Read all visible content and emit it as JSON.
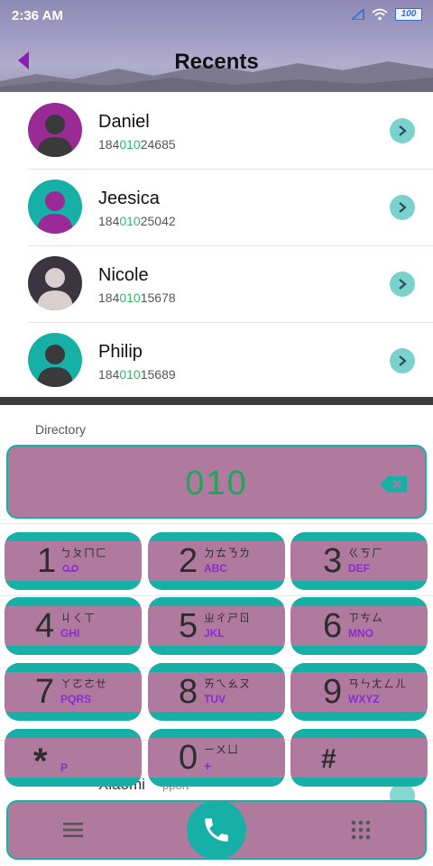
{
  "status": {
    "time": "2:36 AM",
    "battery": "100"
  },
  "header": {
    "title": "Recents"
  },
  "contacts": [
    {
      "name": "Daniel",
      "num_pre": "184",
      "num_hl": "010",
      "num_post": "24685"
    },
    {
      "name": "Jeesica",
      "num_pre": "184",
      "num_hl": "010",
      "num_post": "25042"
    },
    {
      "name": "Nicole",
      "num_pre": "184",
      "num_hl": "010",
      "num_post": "15678"
    },
    {
      "name": "Philip",
      "num_pre": "184",
      "num_hl": "010",
      "num_post": "15689"
    }
  ],
  "directory_label": "Directory",
  "background_items": {
    "name": "Xiaomi",
    "sub": "pport"
  },
  "dial": {
    "number": "010"
  },
  "keys": [
    {
      "digit": "1",
      "zhuyin": "ㄅㄆㄇㄈ",
      "letters": ""
    },
    {
      "digit": "2",
      "zhuyin": "ㄉㄊㄋㄌ",
      "letters": "ABC"
    },
    {
      "digit": "3",
      "zhuyin": "ㄍㄎㄏ",
      "letters": "DEF"
    },
    {
      "digit": "4",
      "zhuyin": "ㄐㄑㄒ",
      "letters": "GHI"
    },
    {
      "digit": "5",
      "zhuyin": "ㄓㄔㄕㄖ",
      "letters": "JKL"
    },
    {
      "digit": "6",
      "zhuyin": "ㄗㄘㄙ",
      "letters": "MNO"
    },
    {
      "digit": "7",
      "zhuyin": "ㄚㄛㄜㄝ",
      "letters": "PQRS"
    },
    {
      "digit": "8",
      "zhuyin": "ㄞㄟㄠㄡ",
      "letters": "TUV"
    },
    {
      "digit": "9",
      "zhuyin": "ㄢㄣㄤㄥㄦ",
      "letters": "WXYZ"
    },
    {
      "digit": "*",
      "zhuyin": "",
      "letters": "P"
    },
    {
      "digit": "0",
      "zhuyin": "ㄧㄨㄩ",
      "letters": "+"
    },
    {
      "digit": "#",
      "zhuyin": "",
      "letters": ""
    }
  ],
  "colors": {
    "accent": "#16b0a7",
    "key_fill": "#b07a9f",
    "highlight": "#2bbf66",
    "letters": "#8a2bd0"
  },
  "icons": {
    "back": "back-arrow-icon",
    "chevron": "chevron-right-icon",
    "backspace": "backspace-icon",
    "call": "phone-icon",
    "menu": "menu-icon",
    "keypad": "keypad-grid-icon"
  }
}
